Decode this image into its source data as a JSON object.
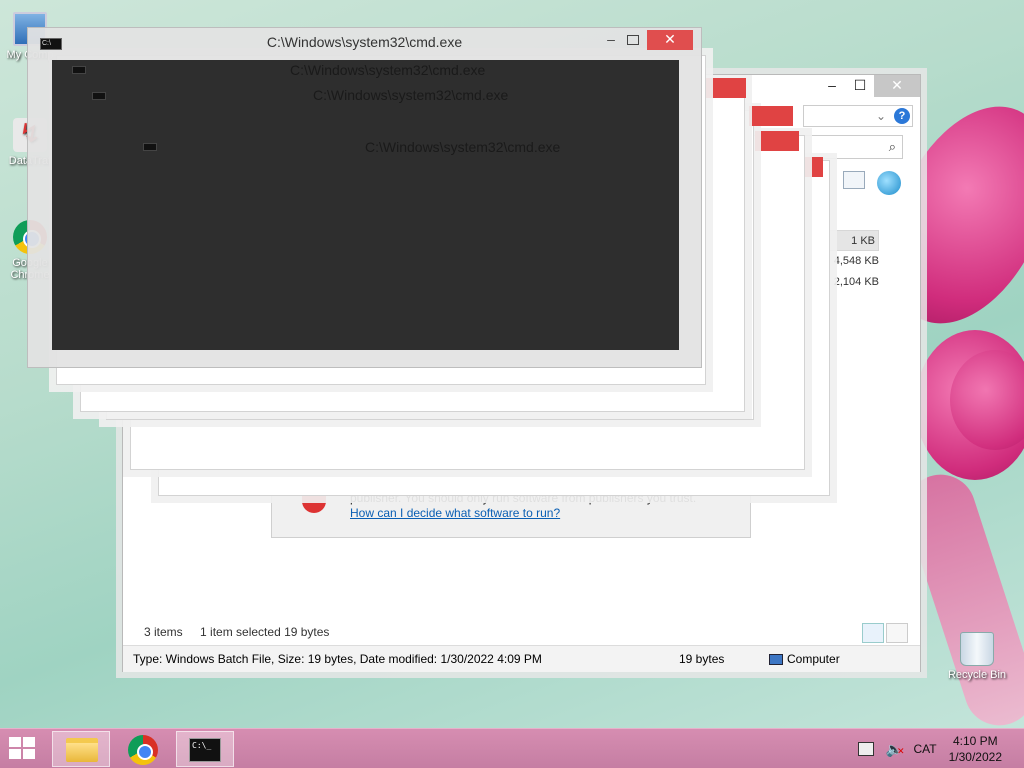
{
  "desktop": {
    "icons": [
      {
        "label": "My Comp",
        "icon": "computer-icon"
      },
      {
        "label": "DataTraf",
        "icon": "datatraffic-icon"
      },
      {
        "label": "Google Chrome",
        "icon": "chrome-icon"
      },
      {
        "label": "Recycle Bin",
        "icon": "recycle-bin-icon"
      }
    ]
  },
  "cmd": {
    "title": "C:\\Windows\\system32\\cmd.exe",
    "echo_titles": [
      "C:\\Windows\\system32\\cmd.exe",
      "C:\\Windows\\system32\\cmd.exe",
      "C:\\Windows\\system32\\cmd.exe"
    ],
    "minimize": "–",
    "close": "✕"
  },
  "explorer": {
    "minimize": "–",
    "maximize": "☐",
    "close": "✕",
    "help": "?",
    "file_sizes": [
      "1 KB",
      "4,548 KB",
      "2,104 KB"
    ],
    "status": {
      "items": "3 items",
      "selected": "1 item selected  19 bytes"
    },
    "details": {
      "type_info": "Type: Windows Batch File, Size: 19 bytes, Date modified: 1/30/2022 4:09 PM",
      "size": "19 bytes",
      "location": "Computer"
    }
  },
  "warning": {
    "text": "publisher. You should only run software from publishers you trust.",
    "link": "How can I decide what software to run?"
  },
  "taskbar": {
    "apps": [
      {
        "name": "File Explorer",
        "icon": "folder-icon"
      },
      {
        "name": "Google Chrome",
        "icon": "chrome-icon"
      },
      {
        "name": "Command Prompt",
        "icon": "cmd-icon"
      }
    ],
    "cmd_icon_text": "C:\\_",
    "language": "CAT",
    "time": "4:10 PM",
    "date": "1/30/2022"
  }
}
